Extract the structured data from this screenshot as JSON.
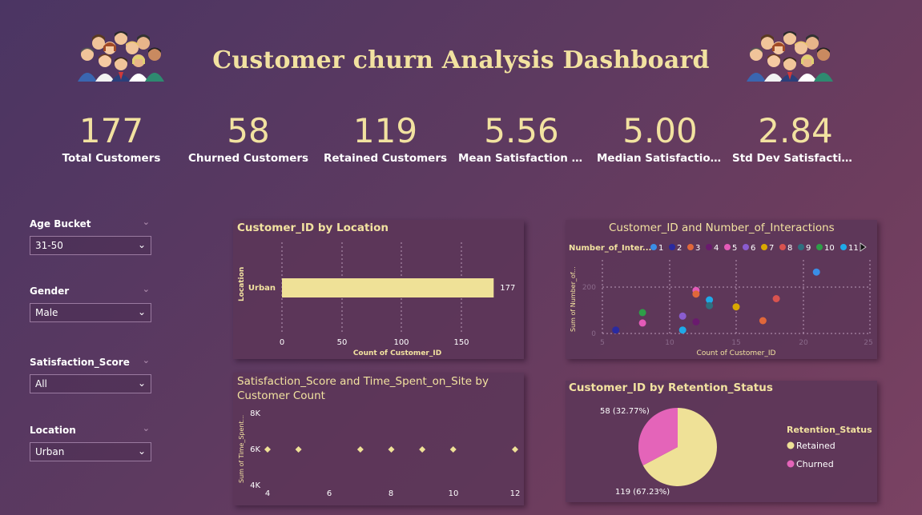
{
  "title": "Customer churn Analysis Dashboard",
  "kpis": [
    {
      "value": "177",
      "label": "Total Customers"
    },
    {
      "value": "58",
      "label": "Churned Customers"
    },
    {
      "value": "119",
      "label": "Retained Customers"
    },
    {
      "value": "5.56",
      "label": "Mean Satisfaction Score"
    },
    {
      "value": "5.00",
      "label": "Median Satisfaction Score"
    },
    {
      "value": "2.84",
      "label": "Std Dev Satisfaction Score"
    }
  ],
  "slicers": [
    {
      "title": "Age Bucket",
      "value": "31-50"
    },
    {
      "title": "Gender",
      "value": "Male"
    },
    {
      "title": "Satisfaction_Score",
      "value": "All"
    },
    {
      "title": "Location",
      "value": "Urban"
    }
  ],
  "colors": {
    "accent": "#f2e2a0",
    "pink": "#e464b9",
    "bar": "#efe197"
  },
  "chart_data": [
    {
      "id": "location",
      "type": "bar",
      "title": "Customer_ID by Location",
      "categories": [
        "Urban"
      ],
      "values": [
        177
      ],
      "data_labels": [
        "177"
      ],
      "xlabel": "Count of Customer_ID",
      "ylabel": "Location",
      "xlim": [
        0,
        180
      ],
      "xticks": [
        "0",
        "50",
        "100",
        "150"
      ],
      "grid": true
    },
    {
      "id": "interactions",
      "type": "scatter",
      "title": "Customer_ID and Number_of_Interactions",
      "legend_title": "Number_of_Inter...",
      "legend": [
        {
          "name": "1",
          "color": "#3a8ee6"
        },
        {
          "name": "2",
          "color": "#2a2aa0"
        },
        {
          "name": "3",
          "color": "#e0673a"
        },
        {
          "name": "4",
          "color": "#6a1a6e"
        },
        {
          "name": "5",
          "color": "#e45ab8"
        },
        {
          "name": "6",
          "color": "#8a5cd0"
        },
        {
          "name": "7",
          "color": "#d9a800"
        },
        {
          "name": "8",
          "color": "#d9534f"
        },
        {
          "name": "9",
          "color": "#2f6f7f"
        },
        {
          "name": "10",
          "color": "#2e9e48"
        },
        {
          "name": "11",
          "color": "#1fa9e8"
        }
      ],
      "points": [
        {
          "x": 6,
          "y": 15,
          "c": "2"
        },
        {
          "x": 8,
          "y": 90,
          "c": "10"
        },
        {
          "x": 8,
          "y": 45,
          "c": "5"
        },
        {
          "x": 11,
          "y": 75,
          "c": "6"
        },
        {
          "x": 11,
          "y": 15,
          "c": "11"
        },
        {
          "x": 12,
          "y": 185,
          "c": "5"
        },
        {
          "x": 12,
          "y": 170,
          "c": "3"
        },
        {
          "x": 12,
          "y": 50,
          "c": "4"
        },
        {
          "x": 13,
          "y": 145,
          "c": "11"
        },
        {
          "x": 13,
          "y": 120,
          "c": "9"
        },
        {
          "x": 15,
          "y": 115,
          "c": "7"
        },
        {
          "x": 17,
          "y": 55,
          "c": "3"
        },
        {
          "x": 18,
          "y": 150,
          "c": "8"
        },
        {
          "x": 21,
          "y": 265,
          "c": "1"
        }
      ],
      "xlabel": "Count of Customer_ID",
      "ylabel": "Sum of Number_of...",
      "xlim": [
        5,
        25
      ],
      "ylim": [
        0,
        300
      ],
      "xticks": [
        "5",
        "10",
        "15",
        "20",
        "25"
      ],
      "yticks": [
        "0",
        "200"
      ]
    },
    {
      "id": "satisfaction",
      "type": "scatter",
      "title": "Satisfaction_Score and Time_Spent_on_Site by Customer Count",
      "ylabel": "Sum of Time_Spent...",
      "xlim": [
        4,
        12
      ],
      "ylim": [
        4000,
        8000
      ],
      "xticks": [
        "4",
        "6",
        "8",
        "10",
        "12"
      ],
      "yticks": [
        "8K",
        "6K",
        "4K"
      ],
      "points": [
        {
          "x": 4,
          "y": 6000
        },
        {
          "x": 5,
          "y": 6000
        },
        {
          "x": 7,
          "y": 6000
        },
        {
          "x": 8,
          "y": 6000
        },
        {
          "x": 9,
          "y": 6000
        },
        {
          "x": 10,
          "y": 6000
        },
        {
          "x": 12,
          "y": 6000
        }
      ]
    },
    {
      "id": "retention",
      "type": "pie",
      "title": "Customer_ID by Retention_Status",
      "legend_title": "Retention_Status",
      "slices": [
        {
          "name": "Retained",
          "value": 119,
          "label": "119 (67.23%)",
          "color": "#efe197"
        },
        {
          "name": "Churned",
          "value": 58,
          "label": "58 (32.77%)",
          "color": "#e464b9"
        }
      ]
    }
  ]
}
